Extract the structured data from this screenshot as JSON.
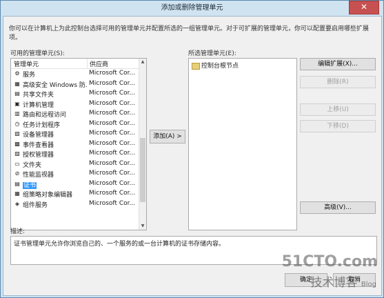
{
  "window": {
    "title": "添加或删除管理单元",
    "close_glyph": "✕"
  },
  "intro_text": "你可以在计算机上为此控制台选择可用的管理单元并配置所选的一组管理单元。对于可扩展的管理单元，你可以配置要启用哪些扩展项。",
  "available": {
    "label": "可用的管理单元(S):",
    "columns": {
      "name": "管理单元",
      "vendor": "供应商"
    },
    "items": [
      {
        "name": "服务",
        "vendor": "Microsoft Cor...",
        "icon": "gear-icon",
        "glyph": "⚙"
      },
      {
        "name": "高级安全 Windows 防...",
        "vendor": "Microsoft Cor...",
        "icon": "firewall-icon",
        "glyph": "▦"
      },
      {
        "name": "共享文件夹",
        "vendor": "Microsoft Cor...",
        "icon": "shared-folder-icon",
        "glyph": "▤"
      },
      {
        "name": "计算机管理",
        "vendor": "Microsoft Cor...",
        "icon": "computer-management-icon",
        "glyph": "▣"
      },
      {
        "name": "路由和远程访问",
        "vendor": "Microsoft Cor...",
        "icon": "routing-icon",
        "glyph": "▥"
      },
      {
        "name": "任务计划程序",
        "vendor": "Microsoft Cor...",
        "icon": "clock-icon",
        "glyph": "◷"
      },
      {
        "name": "设备管理器",
        "vendor": "Microsoft Cor...",
        "icon": "device-icon",
        "glyph": "▧"
      },
      {
        "name": "事件查看器",
        "vendor": "Microsoft Cor...",
        "icon": "event-viewer-icon",
        "glyph": "▩"
      },
      {
        "name": "授权管理器",
        "vendor": "Microsoft Cor...",
        "icon": "authorization-icon",
        "glyph": "▨"
      },
      {
        "name": "文件夹",
        "vendor": "Microsoft Cor...",
        "icon": "folder-icon",
        "glyph": "▭"
      },
      {
        "name": "性能监视器",
        "vendor": "Microsoft Cor...",
        "icon": "performance-icon",
        "glyph": "⊘"
      },
      {
        "name": "证书",
        "vendor": "Microsoft Cor...",
        "icon": "certificate-icon",
        "glyph": "▤",
        "selected": true
      },
      {
        "name": "组策略对象编辑器",
        "vendor": "Microsoft Cor...",
        "icon": "group-policy-icon",
        "glyph": "▦"
      },
      {
        "name": "组件服务",
        "vendor": "Microsoft Cor...",
        "icon": "component-services-icon",
        "glyph": "◈"
      }
    ]
  },
  "add_button": "添加(A) >",
  "selected": {
    "label": "所选管理单元(E):",
    "root": "控制台根节点"
  },
  "side_buttons": {
    "edit_extensions": "编辑扩展(X)...",
    "remove": "删除(R)",
    "move_up": "上移(U)",
    "move_down": "下移(D)",
    "advanced": "高级(V)..."
  },
  "description": {
    "label": "描述:",
    "text": "证书管理单元允许你浏览自己的、一个服务的或一台计算机的证书存储内容。"
  },
  "footer": {
    "ok": "确定",
    "cancel": "取消"
  },
  "watermark": {
    "line1": "51CTO.com",
    "line2": "技术博客",
    "line2_suffix": "Blog"
  }
}
